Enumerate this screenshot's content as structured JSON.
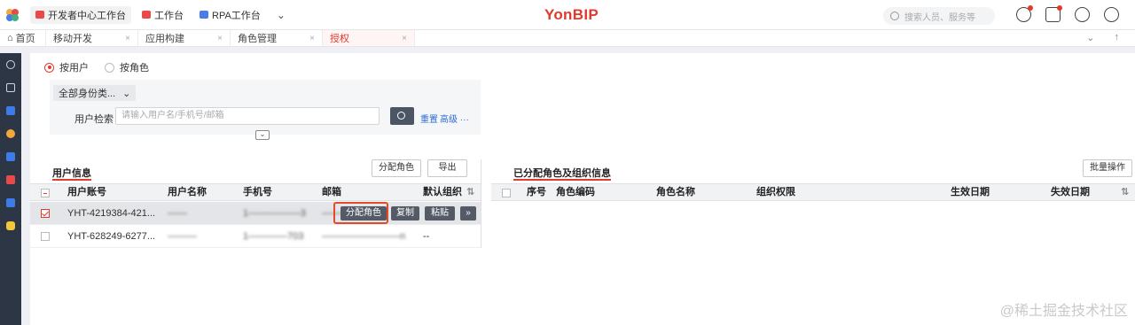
{
  "topbar": {
    "tabs": [
      {
        "label": "开发者中心工作台",
        "color": "#e84a4a",
        "active": true
      },
      {
        "label": "工作台",
        "color": "#e84a4a",
        "active": false
      },
      {
        "label": "RPA工作台",
        "color": "#4a7be8",
        "active": false
      }
    ],
    "brand_a": "Yon",
    "brand_b": "BIP",
    "search_placeholder": "搜索人员、服务等"
  },
  "tabbar": {
    "home": "首页",
    "tabs": [
      {
        "label": "移动开发"
      },
      {
        "label": "应用构建"
      },
      {
        "label": "角色管理"
      },
      {
        "label": "授权",
        "active": true
      }
    ]
  },
  "radios": {
    "by_user": "按用户",
    "by_role": "按角色"
  },
  "filter": {
    "identity": "全部身份类...",
    "user_search_label": "用户检索",
    "user_search_placeholder": "请输入用户名/手机号/邮箱",
    "reset": "重置",
    "advanced": "高级 ···"
  },
  "left_panel": {
    "title": "用户信息",
    "assign_role_button": "分配角色",
    "export_button": "导出",
    "columns": [
      "用户账号",
      "用户名称",
      "手机号",
      "邮箱",
      "默认组织"
    ],
    "rows": [
      {
        "account": "YHT-4219384-421...",
        "name": "——",
        "phone": "1-—————3",
        "email": "—————",
        "org": "",
        "checked": true
      },
      {
        "account": "YHT-628249-6277...",
        "name": "———",
        "phone": "1————703",
        "email": "————————n",
        "org": "--",
        "checked": false
      }
    ],
    "row_actions": {
      "assign_role": "分配角色",
      "copy": "复制",
      "paste": "粘贴",
      "more": "»"
    }
  },
  "right_panel": {
    "title": "已分配角色及组织信息",
    "batch_button": "批量操作",
    "columns": [
      "序号",
      "角色编码",
      "角色名称",
      "组织权限",
      "生效日期",
      "失效日期"
    ]
  },
  "watermark": "@稀土掘金技术社区"
}
